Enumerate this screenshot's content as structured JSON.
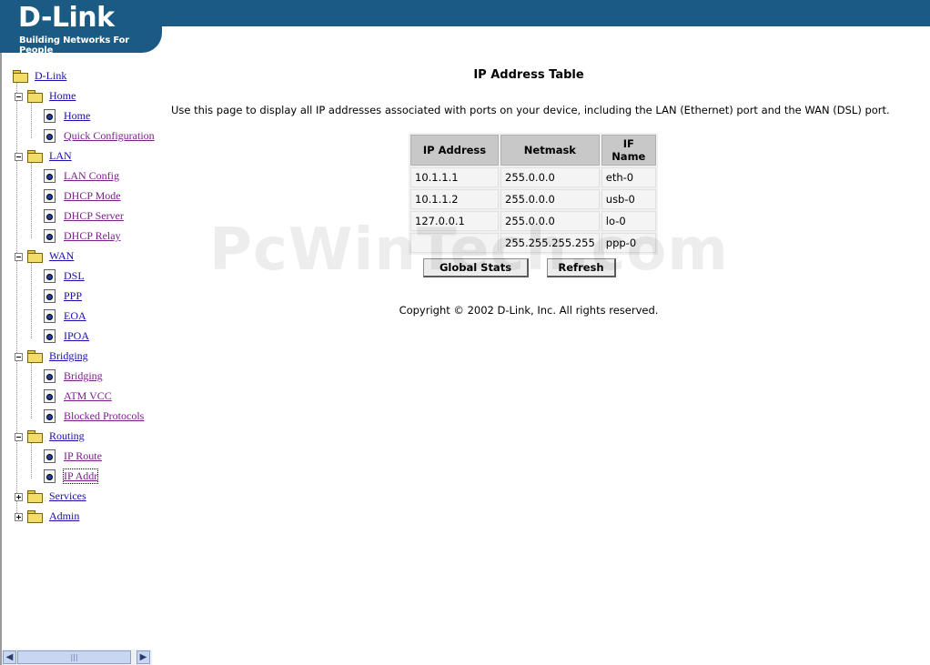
{
  "brand": {
    "logo": "D-Link",
    "tagline": "Building Networks For People"
  },
  "sidebar": {
    "root": "D-Link",
    "groups": [
      {
        "label": "Home",
        "expanded": true,
        "items": [
          "Home",
          "Quick Configuration"
        ]
      },
      {
        "label": "LAN",
        "expanded": true,
        "items": [
          "LAN Config",
          "DHCP Mode",
          "DHCP Server",
          "DHCP Relay"
        ]
      },
      {
        "label": "WAN",
        "expanded": true,
        "items": [
          "DSL",
          "PPP",
          "EOA",
          "IPOA"
        ]
      },
      {
        "label": "Bridging",
        "expanded": true,
        "items": [
          "Bridging",
          "ATM VCC",
          "Blocked Protocols"
        ]
      },
      {
        "label": "Routing",
        "expanded": true,
        "items": [
          "IP Route",
          "IP Addr"
        ]
      },
      {
        "label": "Services",
        "expanded": false,
        "items": []
      },
      {
        "label": "Admin",
        "expanded": false,
        "items": []
      }
    ]
  },
  "main": {
    "title": "IP Address Table",
    "description": "Use this page to display all IP addresses associated with ports on your device, including the LAN (Ethernet) port and the WAN (DSL) port.",
    "table": {
      "headers": [
        "IP Address",
        "Netmask",
        "IF Name"
      ],
      "rows": [
        [
          "10.1.1.1",
          "255.0.0.0",
          "eth-0"
        ],
        [
          "10.1.1.2",
          "255.0.0.0",
          "usb-0"
        ],
        [
          "127.0.0.1",
          "255.0.0.0",
          "lo-0"
        ],
        [
          "",
          "255.255.255.255",
          "ppp-0"
        ]
      ]
    },
    "buttons": {
      "global_stats": "Global Stats",
      "refresh": "Refresh"
    },
    "copyright": "Copyright © 2002 D-Link, Inc. All rights reserved."
  },
  "watermark": "PcWinTech.com",
  "colors": {
    "banner": "#1b5a82",
    "link": "#1a0dab",
    "visited_link": "#7a1f8a",
    "table_header": "#c8c8c8"
  }
}
